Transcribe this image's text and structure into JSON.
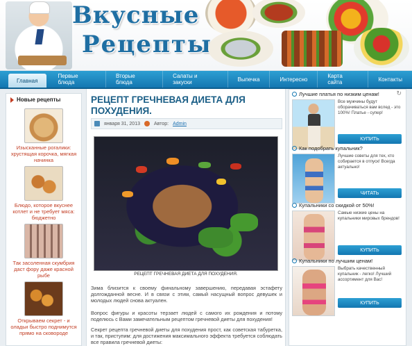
{
  "header": {
    "logo_line1": "Вкусные",
    "logo_line2": "Рецепты"
  },
  "nav": {
    "items": [
      "Главная",
      "Первые блюда",
      "Вторые блюда",
      "Салаты и закуски",
      "Выпечка",
      "Интересно",
      "Карта сайта",
      "Контакты"
    ],
    "active": "Главная"
  },
  "left": {
    "title": "Новые рецепты",
    "recipes": [
      "Изысканные рогалики: хрустящая корочка, мягкая начинка",
      "Блюдо, которое вкуснее котлет и не требует мяса: бюджетно",
      "Так засоленная скумбрия даст фору даже красной рыбе",
      "Открываем секрет - и оладьи быстро поднимутся прямо на сковороде"
    ]
  },
  "article": {
    "title": "Рецепт гречневая диета для похудения.",
    "date": "января 31, 2013",
    "author_label": "Автор:",
    "author": "Admin",
    "photo_caption": "РЕЦЕПТ ГРЕЧНЕВАЯ ДИЕТА ДЛЯ ПОХУДЕНИЯ.",
    "p1": "Зима близится к своему финальному завершению, передавая эстафету долгожданной весне. И в связи с этим, самый насущный вопрос девушек и молодых людей снова актуален.",
    "p2": "Вопрос фигуры и красоты терзает людей с самого их рождения и потому поделюсь с Вами замечательным рецептом гречневой диеты для похудения!",
    "p3": "Секрет рецепта гречневой диеты для похудения прост, как советская табуретка, и так, приступим: для достижения максимального эффекта требуется соблюдать все правила гречневой диеты:"
  },
  "right": {
    "refresh_icon": "↻",
    "ads": [
      {
        "title": "Лучшие платья по низким ценам!",
        "desc": "Все мужчины будут оборачиваться вам вслед - это 100%! Платье - супер!",
        "button": "КУПИТЬ"
      },
      {
        "title": "Как подобрать купальник?",
        "desc": "Лучшие советы для тех, кто собирается в отпуск! Всегда актуально!",
        "button": "ЧИТАТЬ"
      },
      {
        "title": "Купальники со скидкой от 50%!",
        "desc": "Самые низкие цены на купальники мировых брендов!",
        "button": "КУПИТЬ"
      },
      {
        "title": "Купальники по лучшим ценам!",
        "desc": "Выбрать качественный купальник - легко! Лучший ассортимент для Вас!",
        "button": "КУПИТЬ"
      }
    ]
  }
}
